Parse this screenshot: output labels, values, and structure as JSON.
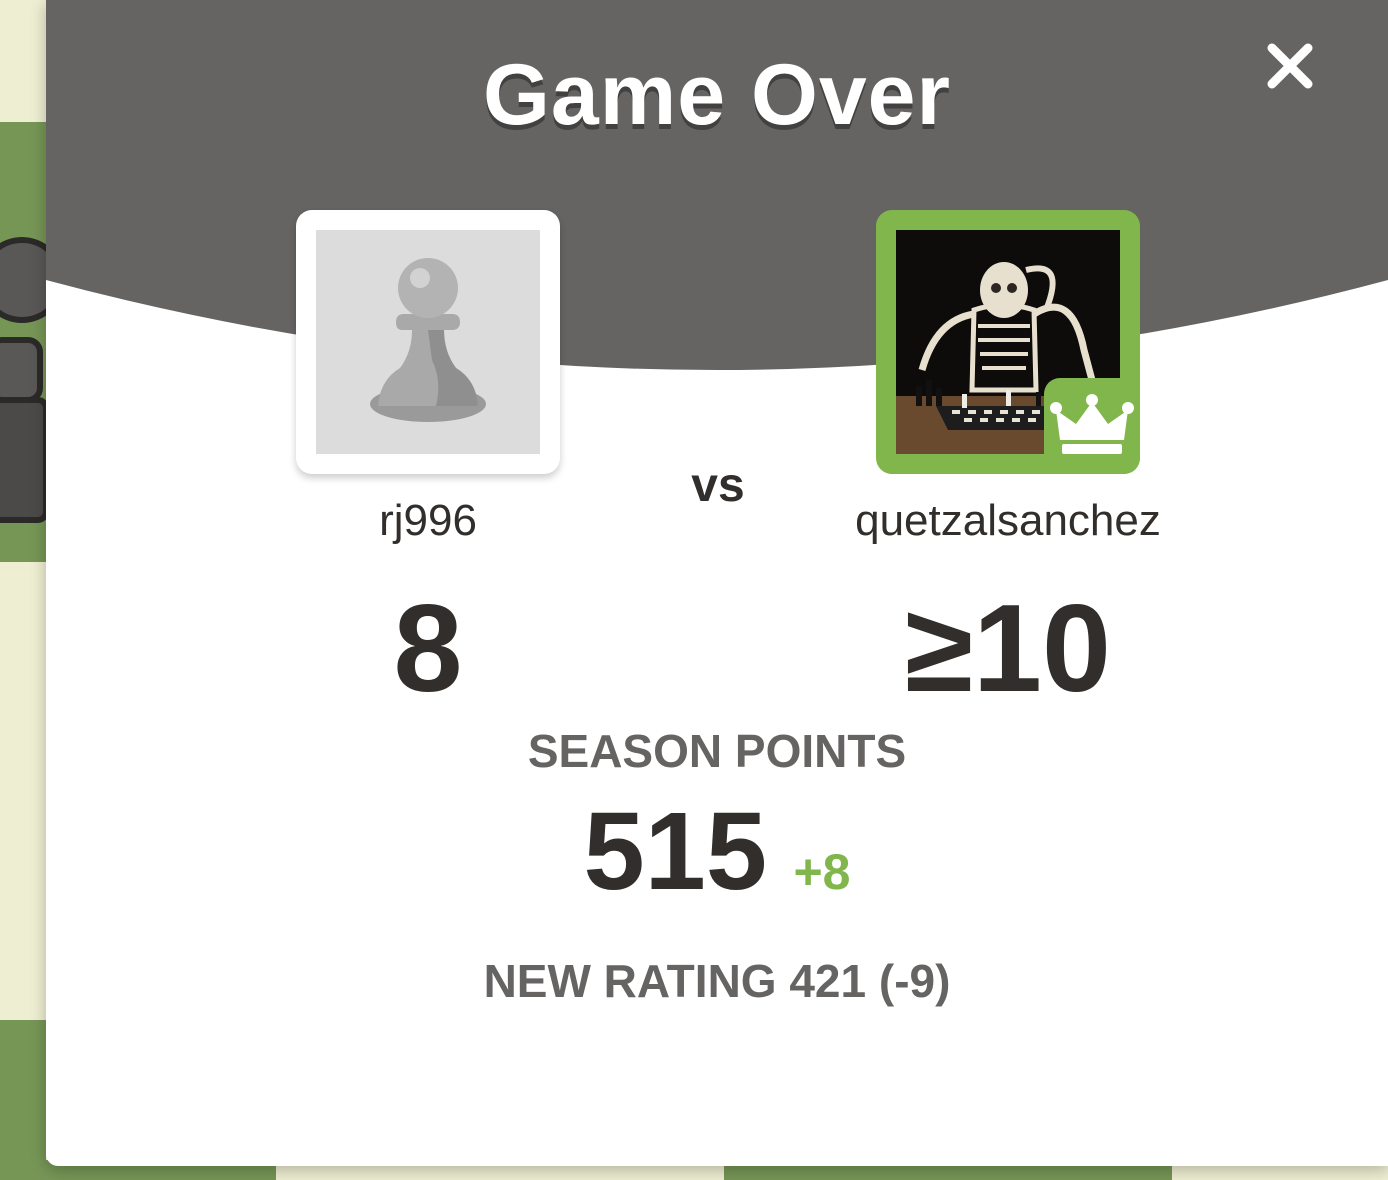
{
  "modal": {
    "title": "Game Over",
    "close_icon": "close-icon"
  },
  "players": {
    "left": {
      "username": "rj996",
      "score": "8",
      "avatar": "pawn-icon"
    },
    "right": {
      "username": "quetzalsanchez",
      "score": "≥10",
      "avatar": "skeleton-playing-chess-photo",
      "badge": "crown-icon"
    },
    "vs_label": "vs"
  },
  "season": {
    "label": "SEASON POINTS",
    "value": "515",
    "delta": "+8"
  },
  "rating": {
    "text": "NEW RATING 421 (-9)"
  },
  "colors": {
    "header_gray": "#666463",
    "accent_green": "#81b64c",
    "text_dark": "#312e2b"
  }
}
